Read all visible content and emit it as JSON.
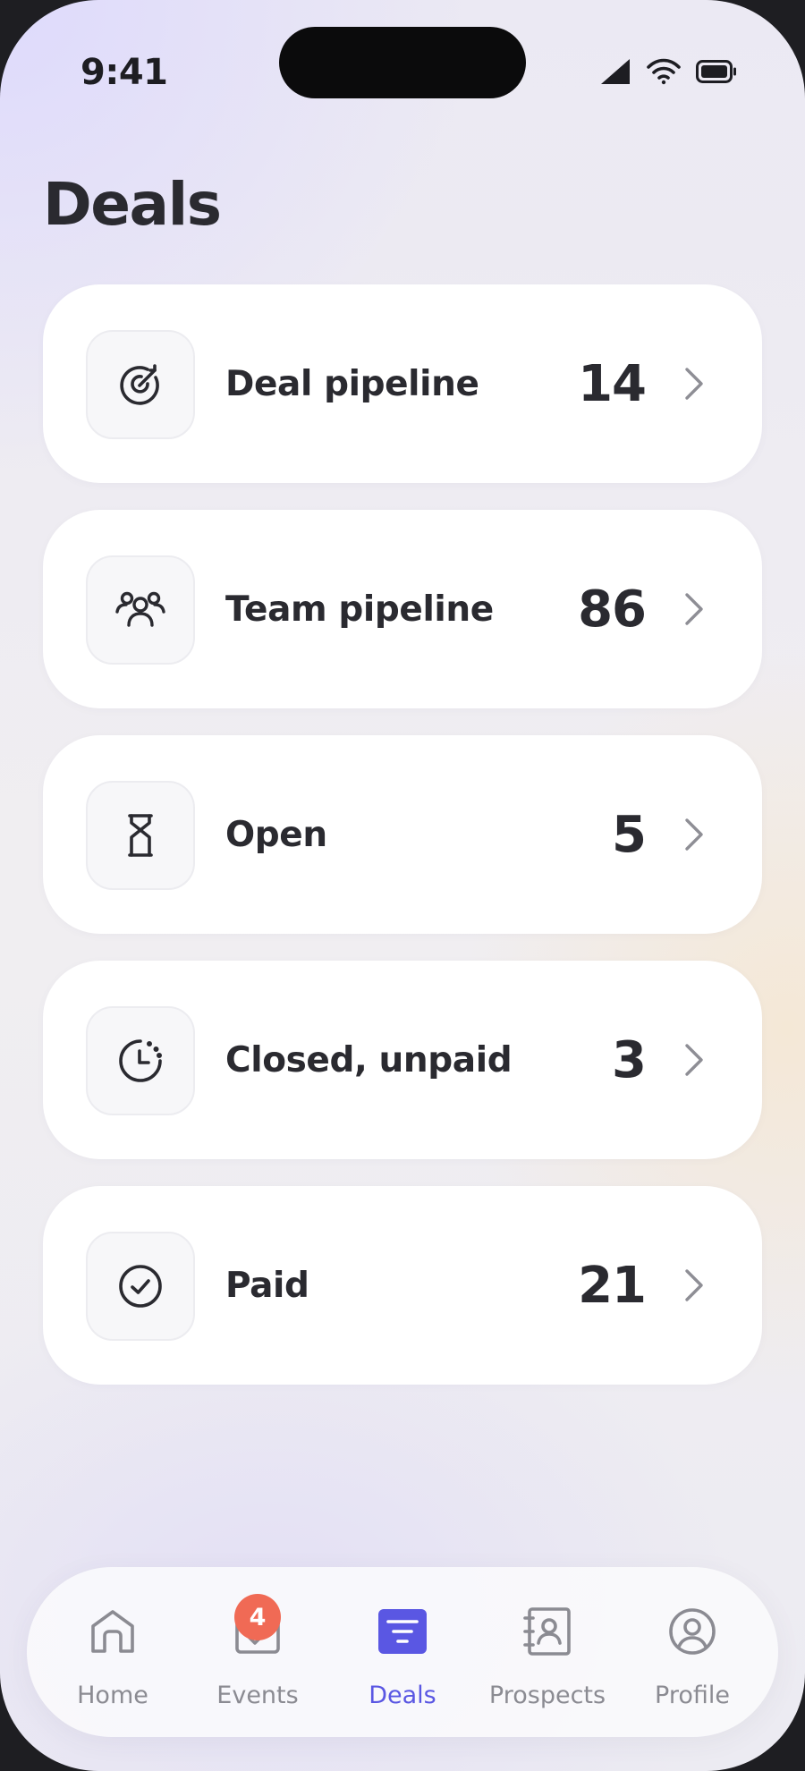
{
  "status_bar": {
    "time": "9:41",
    "icons": [
      "cellular-signal-icon",
      "wifi-icon",
      "battery-icon"
    ]
  },
  "page": {
    "title": "Deals"
  },
  "cards": [
    {
      "label": "Deal pipeline",
      "count": "14",
      "icon": "target-icon"
    },
    {
      "label": "Team pipeline",
      "count": "86",
      "icon": "team-icon"
    },
    {
      "label": "Open",
      "count": "5",
      "icon": "hourglass-icon"
    },
    {
      "label": "Closed, unpaid",
      "count": "3",
      "icon": "clock-pending-icon"
    },
    {
      "label": "Paid",
      "count": "21",
      "icon": "check-circle-icon"
    }
  ],
  "tabbar": {
    "active": "Deals",
    "tabs": [
      {
        "label": "Home",
        "icon": "home-icon"
      },
      {
        "label": "Events",
        "icon": "calendar-check-icon",
        "badge": "4"
      },
      {
        "label": "Deals",
        "icon": "filter-list-icon"
      },
      {
        "label": "Prospects",
        "icon": "contact-book-icon"
      },
      {
        "label": "Profile",
        "icon": "user-circle-icon"
      }
    ]
  },
  "colors": {
    "accent": "#5a57e3",
    "badge": "#f06a55",
    "text": "#2a2a30",
    "inactive": "#8b8b92"
  }
}
